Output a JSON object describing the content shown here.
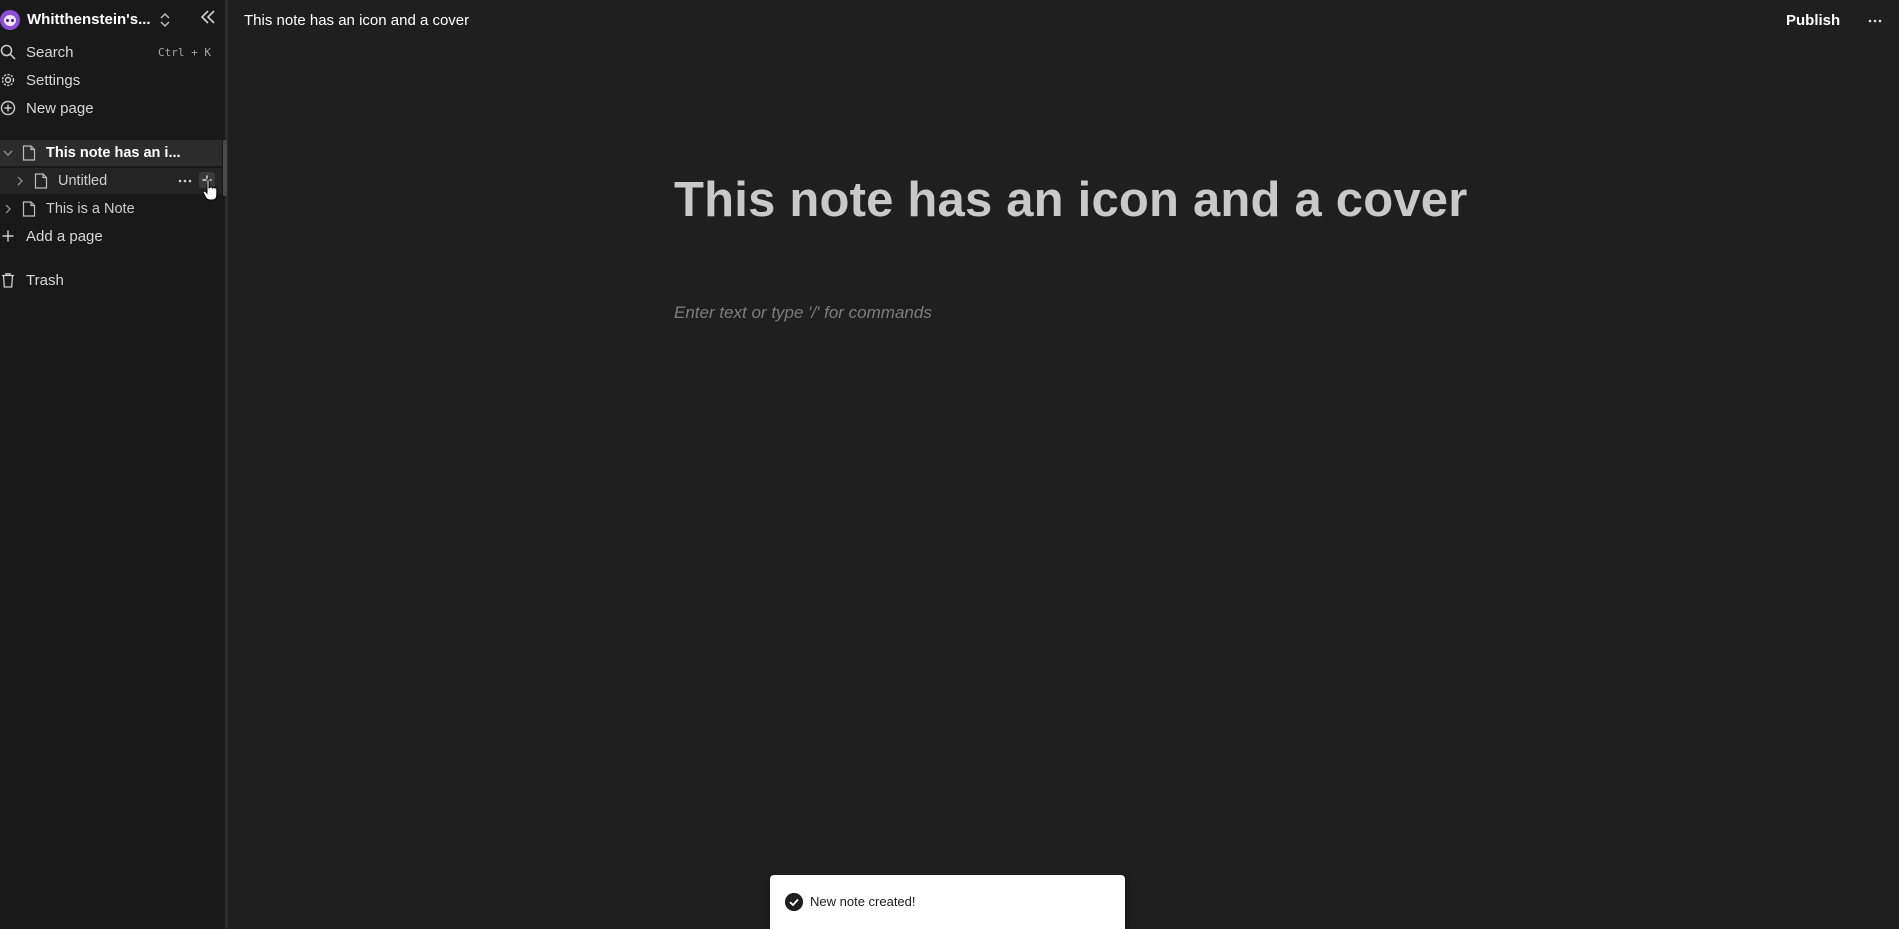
{
  "sidebar": {
    "workspace_name": "Whitthenstein's...",
    "menu": {
      "search_label": "Search",
      "search_shortcut": "Ctrl + K",
      "settings_label": "Settings",
      "new_page_label": "New page"
    },
    "tree": [
      {
        "label": "This note has an i...",
        "state": "selected",
        "expanded": true
      },
      {
        "label": "Untitled",
        "state": "hovered",
        "expanded": false
      },
      {
        "label": "This is a Note",
        "state": "normal",
        "expanded": false
      }
    ],
    "add_page_label": "Add a page",
    "trash_label": "Trash"
  },
  "topbar": {
    "breadcrumb_title": "This note has an icon and a cover",
    "publish_label": "Publish"
  },
  "editor": {
    "title": "This note has an icon and a cover",
    "placeholder": "Enter text or type '/' for commands"
  },
  "toast": {
    "message": "New note created!"
  },
  "icons": {
    "search": "search-icon",
    "settings": "gear-icon",
    "new_page": "plus-circle-icon",
    "page": "document-icon",
    "trash": "trash-icon",
    "more": "more-horizontal-icon",
    "collapse": "chevrons-left-icon",
    "switcher": "chevron-up-down-icon",
    "toast": "check-circle-icon"
  },
  "colors": {
    "background": "#1f1f1f",
    "sidebar": "#191919",
    "selected_row": "#2c2c2c",
    "toast_bg": "#ffffff"
  }
}
